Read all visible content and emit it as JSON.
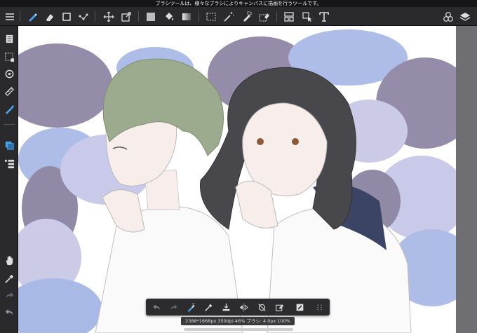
{
  "tooltip": {
    "text": "ブラシツールは、様々なブラシによりキャンバスに描画を行うツールです。"
  },
  "top_toolbar": {
    "icons": [
      "menu-icon",
      "brush-icon",
      "eraser-icon",
      "rectangle-icon",
      "dots-icon",
      "move-icon",
      "transform-icon",
      "fill-color-icon",
      "bucket-icon",
      "gradient-icon",
      "select-rect-icon",
      "magic-wand-icon",
      "select-pen-icon",
      "select-eraser-icon",
      "frame-icon",
      "pointer-icon",
      "text-icon",
      "material-icon",
      "layers-icon"
    ]
  },
  "left_toolbar": {
    "icons": [
      "pages-icon",
      "selection-icon",
      "rotate-icon",
      "ruler-icon",
      "brush-active-icon",
      "layer-color-icon",
      "layer-list-icon",
      "hand-icon",
      "eyedropper-icon",
      "redo-icon",
      "undo-icon"
    ]
  },
  "float_toolbar": {
    "icons": [
      "undo-icon",
      "redo-icon",
      "stabilizer-brush-icon",
      "eyedropper-icon",
      "save-icon",
      "flip-icon",
      "rotate-off-icon",
      "edit-icon",
      "color-square-icon",
      "grip-icon"
    ]
  },
  "status": {
    "text": "2388*1668px 350dpi 46% ブラシ: 4.0px 100%"
  },
  "colors": {
    "accent": "#4aa3e8",
    "toolbar_bg": "#2a2a2d"
  }
}
